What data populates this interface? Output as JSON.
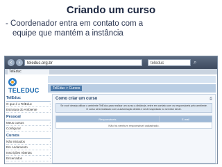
{
  "slide": {
    "title": "Criando um curso",
    "bullet_line1": "- Coordenador entra em contato com a",
    "bullet_line2": "equipe que mantém a instância"
  },
  "browser": {
    "url": "teleduc.org.br",
    "search_placeholder": "teleduc",
    "tab_label": "TelEduc"
  },
  "app": {
    "logo_text": "TELEDUC",
    "breadcrumb": "TelEduc > Cursos",
    "sidebar": {
      "groups": [
        {
          "title": "TelEduc",
          "items": [
            "O que é o TelEduc",
            "Estrutura do Ambiente"
          ]
        },
        {
          "title": "Pessoal",
          "items": [
            "Meus cursos",
            "Configurar"
          ]
        },
        {
          "title": "Cursos",
          "items": [
            "Não iniciados",
            "Em Andamento",
            "Inscrições Abertas",
            "Encerrados"
          ]
        }
      ]
    },
    "main": {
      "title": "Como criar um curso",
      "notice_line1": "Se você deseja utilizar o ambiente TelEduc para realizar um curso a distância, entre em contato com os responsáveis pelo ambiente.",
      "notice_line2": "O curso será realizado com a autorização destes e será hospedado no servidor deste.",
      "table_headers": [
        "Responsáveis",
        "E-mail"
      ],
      "table_empty": "Não há nenhum responsável cadastrado."
    }
  },
  "colors": {
    "title": "#1c2740",
    "brand_blue": "#0a5ea8",
    "browser_chrome": "#3d4a5e"
  }
}
